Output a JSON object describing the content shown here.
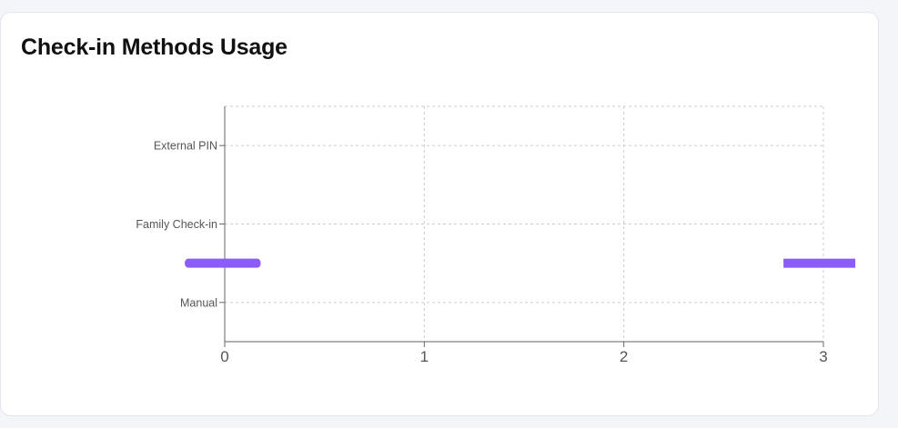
{
  "card": {
    "title": "Check-in Methods Usage"
  },
  "colors": {
    "bar": "#8b5cf6",
    "grid": "#cccccc",
    "axis": "#666666",
    "card_bg": "#ffffff",
    "page_bg": "#f3f5f8"
  },
  "chart_data": {
    "type": "bar",
    "orientation": "horizontal",
    "title": "Check-in Methods Usage",
    "categories": [
      "External PIN",
      "Family Check-in",
      "Manual"
    ],
    "x_ticks": [
      0,
      1,
      2,
      3
    ],
    "xlim": [
      0,
      3
    ],
    "xlabel": "",
    "ylabel": "",
    "grid": true,
    "grid_style": "dashed",
    "series": [
      {
        "values": [
          0,
          0,
          0
        ]
      }
    ],
    "stray_bars": [
      {
        "from": -0.2,
        "to": 0.18
      },
      {
        "from": 2.8,
        "to": 3.16
      }
    ]
  }
}
